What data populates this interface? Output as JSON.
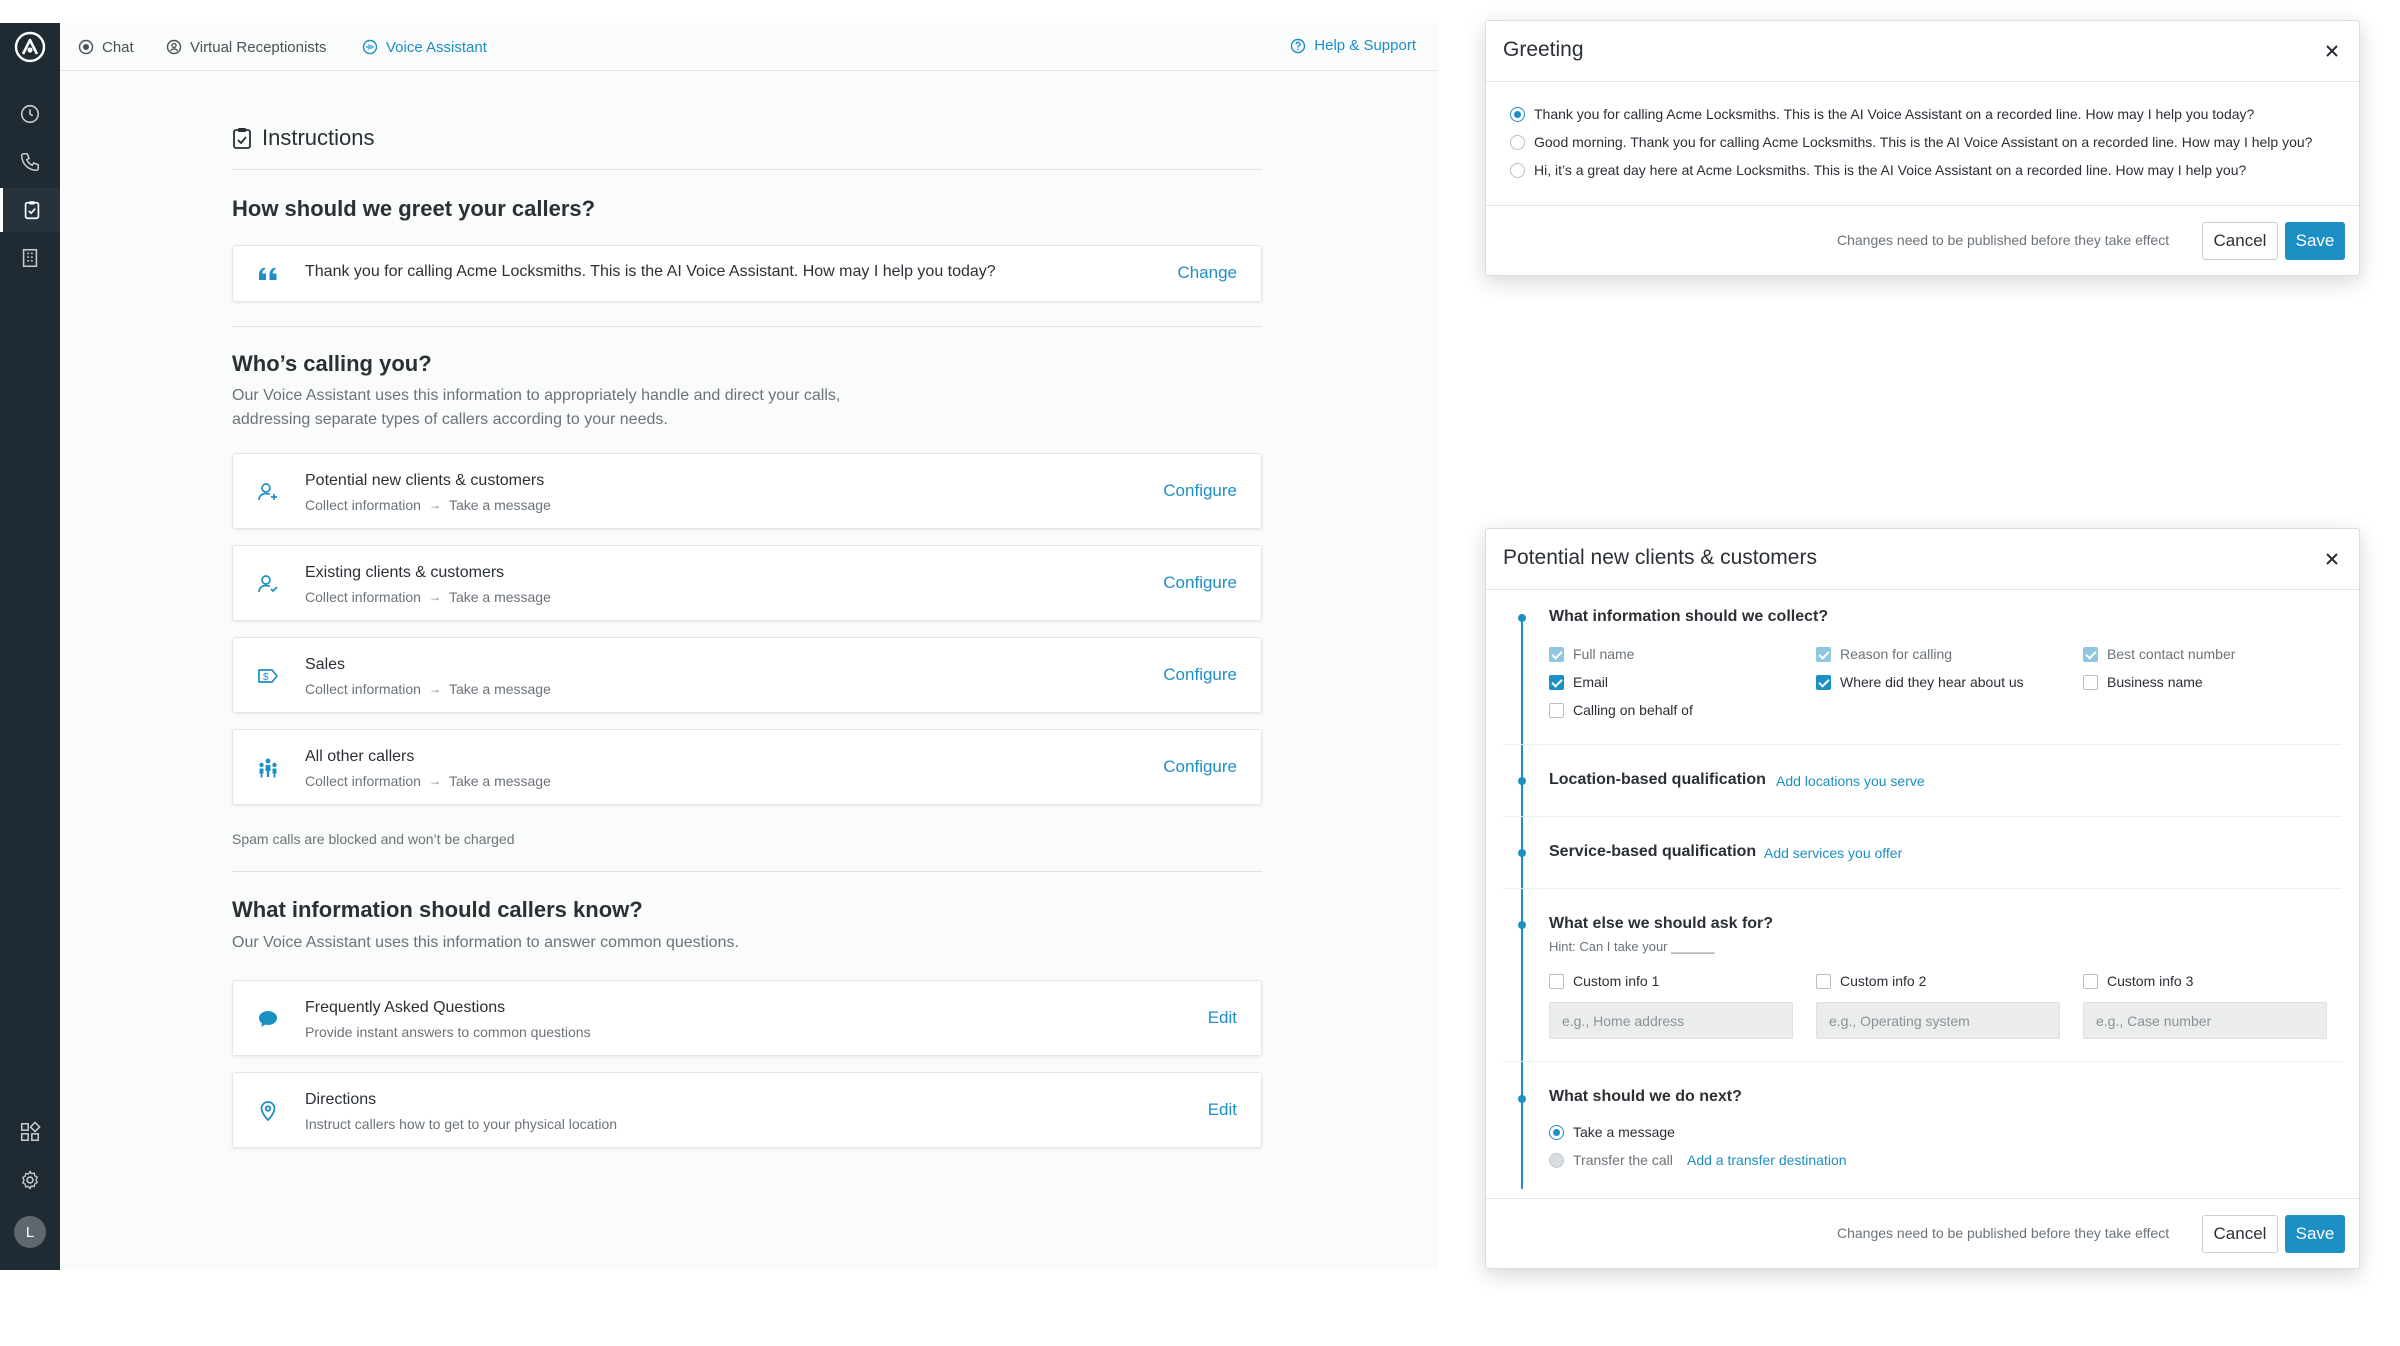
{
  "nav": {
    "tabs": [
      {
        "label": "Chat",
        "icon": "chat-icon"
      },
      {
        "label": "Virtual Receptionists",
        "icon": "receptionist-icon"
      },
      {
        "label": "Voice Assistant",
        "icon": "voice-assistant-icon",
        "active": true
      }
    ],
    "help_label": "Help & Support",
    "avatar_initial": "L",
    "rail_icons": [
      "logo-icon",
      "history-icon",
      "phone-icon",
      "clipboard-icon",
      "building-icon",
      "apps-icon",
      "settings-icon"
    ]
  },
  "main": {
    "instructions_title": "Instructions",
    "greet": {
      "heading": "How should we greet your callers?",
      "text": "Thank you for calling Acme Locksmiths. This is the AI Voice Assistant. How may I help you today?",
      "action": "Change"
    },
    "callers": {
      "heading": "Who’s calling you?",
      "desc_line1": "Our Voice Assistant uses this information to appropriately handle and direct your calls,",
      "desc_line2": "addressing separate types of callers according to your needs.",
      "items": [
        {
          "title": "Potential new clients & customers",
          "sub_a": "Collect information",
          "sub_b": "Take a message",
          "action": "Configure"
        },
        {
          "title": "Existing clients & customers",
          "sub_a": "Collect information",
          "sub_b": "Take a message",
          "action": "Configure"
        },
        {
          "title": "Sales",
          "sub_a": "Collect information",
          "sub_b": "Take a message",
          "action": "Configure"
        },
        {
          "title": "All other callers",
          "sub_a": "Collect information",
          "sub_b": "Take a message",
          "action": "Configure"
        }
      ],
      "spam_note": "Spam calls are blocked and won’t be charged"
    },
    "know": {
      "heading": "What information should callers know?",
      "desc": "Our Voice Assistant uses this information to answer common questions.",
      "items": [
        {
          "title": "Frequently Asked Questions",
          "sub": "Provide instant answers to common questions",
          "action": "Edit"
        },
        {
          "title": "Directions",
          "sub": "Instruct callers how to get to your physical location",
          "action": "Edit"
        }
      ]
    }
  },
  "greeting_dialog": {
    "title": "Greeting",
    "options": [
      {
        "text": "Thank you for calling Acme Locksmiths. This is the AI Voice Assistant on a recorded line. How may I help you today?",
        "selected": true
      },
      {
        "text": "Good morning. Thank you for calling Acme Locksmiths. This is the AI Voice Assistant on a recorded line. How may I help you?",
        "selected": false
      },
      {
        "text": "Hi, it’s a great day here at Acme Locksmiths. This is the AI Voice Assistant on a recorded line. How may I help you?",
        "selected": false
      }
    ],
    "footnote": "Changes need to be published before they take effect",
    "cancel": "Cancel",
    "save": "Save"
  },
  "clients_dialog": {
    "title": "Potential new clients & customers",
    "collect": {
      "heading": "What information should we collect?",
      "fields": [
        {
          "label": "Full name",
          "state": "locked"
        },
        {
          "label": "Reason for calling",
          "state": "locked"
        },
        {
          "label": "Best contact number",
          "state": "locked"
        },
        {
          "label": "Email",
          "state": "checked"
        },
        {
          "label": "Where did they hear about us",
          "state": "checked"
        },
        {
          "label": "Business name",
          "state": "unchecked"
        },
        {
          "label": "Calling on behalf of",
          "state": "unchecked"
        }
      ]
    },
    "location": {
      "heading": "Location-based qualification",
      "link": "Add locations you serve"
    },
    "service": {
      "heading": "Service-based qualification",
      "link": "Add services you offer"
    },
    "custom": {
      "heading": "What else we should ask for?",
      "hint": "Hint: Can I take your ______",
      "items": [
        {
          "label": "Custom info 1",
          "placeholder": "e.g., Home address"
        },
        {
          "label": "Custom info 2",
          "placeholder": "e.g., Operating system"
        },
        {
          "label": "Custom info 3",
          "placeholder": "e.g., Case number"
        }
      ]
    },
    "next": {
      "heading": "What should we do next?",
      "option1": "Take a message",
      "option2": "Transfer the call",
      "option2_link": "Add a transfer destination"
    },
    "footnote": "Changes need to be published before they take effect",
    "cancel": "Cancel",
    "save": "Save"
  },
  "colors": {
    "accent": "#1c8fc4",
    "rail": "#1f2a33",
    "text": "#2b3036",
    "muted": "#6b737a"
  }
}
